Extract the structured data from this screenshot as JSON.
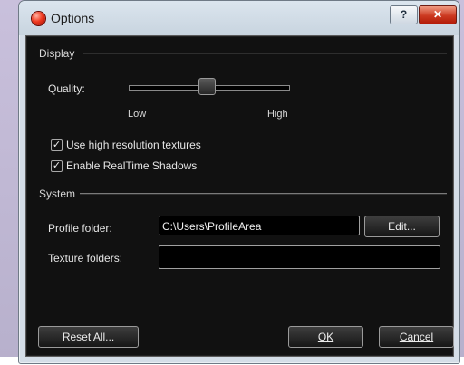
{
  "window": {
    "title": "Options",
    "help_label": "?",
    "close_label": "✕"
  },
  "display": {
    "section_title": "Display",
    "quality_label": "Quality:",
    "quality_low": "Low",
    "quality_high": "High",
    "quality_value": 0.5,
    "hires_label": "Use high resolution textures",
    "hires_checked": true,
    "shadows_label": "Enable RealTime Shadows",
    "shadows_checked": true
  },
  "system": {
    "section_title": "System",
    "profile_label": "Profile folder:",
    "profile_value": "C:\\Users\\ProfileArea",
    "edit_label": "Edit...",
    "texture_label": "Texture folders:",
    "texture_value": ""
  },
  "footer": {
    "reset_label": "Reset All...",
    "ok_label": "OK",
    "cancel_label": "Cancel"
  },
  "icons": {
    "app_icon": "red-ball-icon",
    "check_icon": "checkmark-icon"
  }
}
